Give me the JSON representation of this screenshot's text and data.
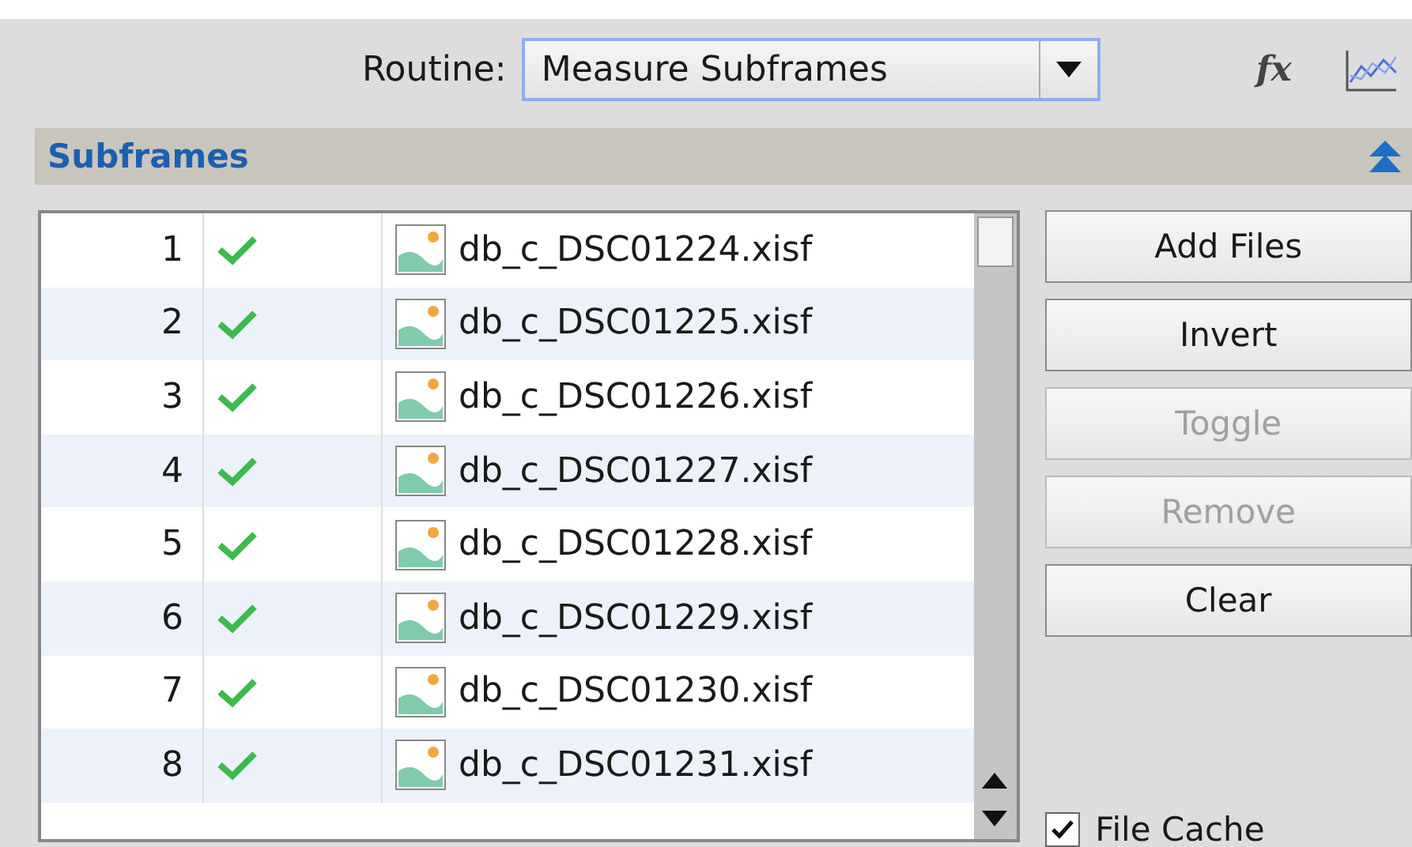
{
  "toolbar": {
    "routine_label": "Routine:",
    "routine_value": "Measure Subframes",
    "formula_icon": "fx"
  },
  "section": {
    "title": "Subframes",
    "expanded": true
  },
  "files": [
    {
      "index": "1",
      "enabled": true,
      "name": "db_c_DSC01224.xisf"
    },
    {
      "index": "2",
      "enabled": true,
      "name": "db_c_DSC01225.xisf"
    },
    {
      "index": "3",
      "enabled": true,
      "name": "db_c_DSC01226.xisf"
    },
    {
      "index": "4",
      "enabled": true,
      "name": "db_c_DSC01227.xisf"
    },
    {
      "index": "5",
      "enabled": true,
      "name": "db_c_DSC01228.xisf"
    },
    {
      "index": "6",
      "enabled": true,
      "name": "db_c_DSC01229.xisf"
    },
    {
      "index": "7",
      "enabled": true,
      "name": "db_c_DSC01230.xisf"
    },
    {
      "index": "8",
      "enabled": true,
      "name": "db_c_DSC01231.xisf"
    }
  ],
  "buttons": [
    {
      "label": "Add Files",
      "disabled": false
    },
    {
      "label": "Invert",
      "disabled": false
    },
    {
      "label": "Toggle",
      "disabled": true
    },
    {
      "label": "Remove",
      "disabled": true
    },
    {
      "label": "Clear",
      "disabled": false
    }
  ],
  "file_cache": {
    "label": "File Cache",
    "checked": true
  }
}
